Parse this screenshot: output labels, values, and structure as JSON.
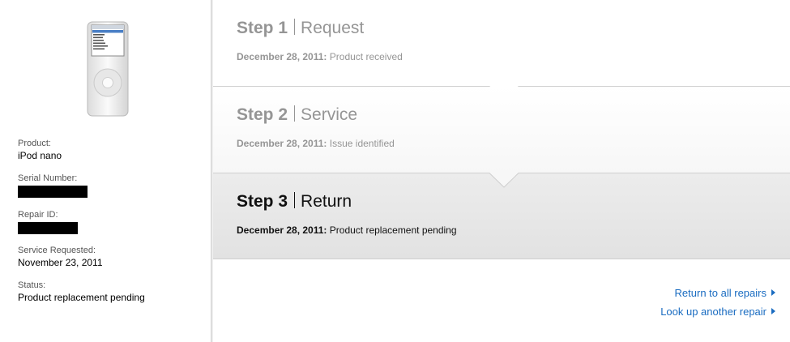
{
  "sidebar": {
    "device": {
      "icon": "ipod-nano-icon",
      "screen_title": "iPod",
      "menu_items": [
        "Music",
        "Photos",
        "Videos",
        "Extras",
        "Settings",
        "Shuffle Songs",
        "Backlight"
      ]
    },
    "product_label": "Product:",
    "product_value": "iPod nano",
    "serial_label": "Serial Number:",
    "repair_id_label": "Repair ID:",
    "service_requested_label": "Service Requested:",
    "service_requested_value": "November 23, 2011",
    "status_label": "Status:",
    "status_value": "Product replacement pending"
  },
  "steps": [
    {
      "number": "Step 1",
      "name": "Request",
      "date": "December 28, 2011:",
      "detail": "Product received",
      "state": "done"
    },
    {
      "number": "Step 2",
      "name": "Service",
      "date": "December 28, 2011:",
      "detail": "Issue identified",
      "state": "done"
    },
    {
      "number": "Step 3",
      "name": "Return",
      "date": "December 28, 2011:",
      "detail": "Product replacement pending",
      "state": "current"
    }
  ],
  "links": {
    "return_all": "Return to all repairs",
    "look_up": "Look up another repair"
  },
  "colors": {
    "link": "#1a6cc1",
    "inactive_text": "#959595",
    "active_background": "#e6e6e6"
  }
}
